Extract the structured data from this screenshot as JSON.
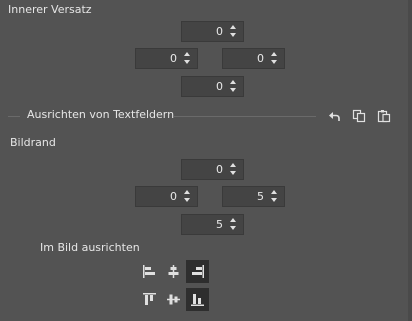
{
  "inner_offset": {
    "title": "Innerer Versatz",
    "top": "0",
    "left": "0",
    "right": "0",
    "bottom": "0"
  },
  "text_align_section": {
    "title": "Ausrichten von Textfeldern",
    "tools": [
      "undo-icon",
      "copy-icon",
      "paste-icon"
    ]
  },
  "margin": {
    "title": "Bildrand",
    "top": "0",
    "left": "0",
    "right": "5",
    "bottom": "5"
  },
  "align_in_image": {
    "title": "Im Bild ausrichten",
    "buttons": [
      {
        "name": "align-left-icon",
        "active": false
      },
      {
        "name": "align-center-horizontal-icon",
        "active": false
      },
      {
        "name": "align-right-icon",
        "active": true
      },
      {
        "name": "align-top-icon",
        "active": false
      },
      {
        "name": "align-center-vertical-icon",
        "active": false
      },
      {
        "name": "align-bottom-icon",
        "active": true
      }
    ]
  }
}
